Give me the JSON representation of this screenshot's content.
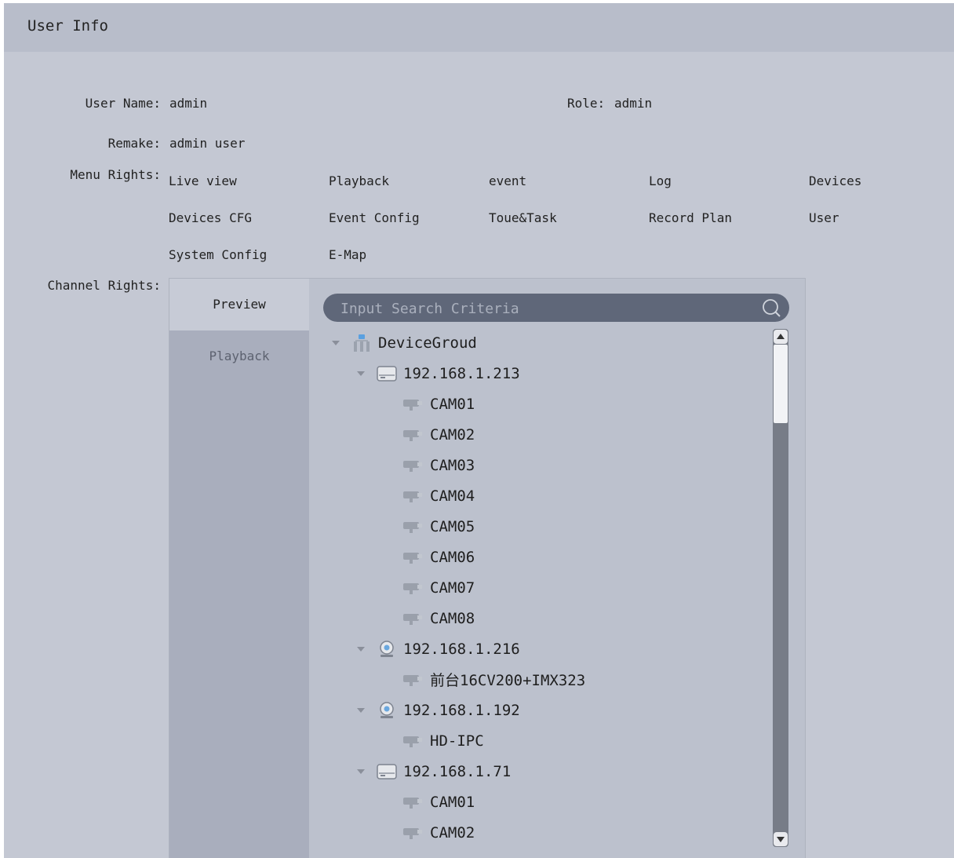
{
  "window": {
    "title": "User Info"
  },
  "user": {
    "name_label": "User Name:",
    "name_value": "admin",
    "role_label": "Role:",
    "role_value": "admin",
    "remark_label": "Remake:",
    "remark_value": "admin user"
  },
  "menu_rights": {
    "label": "Menu Rights:",
    "items": [
      "Live view",
      "Playback",
      "event",
      "Log",
      "Devices",
      "Devices CFG",
      "Event Config",
      "Toue&Task",
      "Record Plan",
      "User",
      "System Config",
      "E-Map"
    ]
  },
  "channel_rights": {
    "label": "Channel Rights:",
    "tabs": [
      "Preview",
      "Playback"
    ],
    "search_placeholder": "Input Search Criteria",
    "tree": [
      {
        "label": "DeviceGroud",
        "icon": "device-group-icon",
        "expanded": true
      },
      {
        "label": "192.168.1.213",
        "icon": "nvr-icon",
        "expanded": true
      },
      {
        "label": "CAM01",
        "icon": "camera-icon"
      },
      {
        "label": "CAM02",
        "icon": "camera-icon"
      },
      {
        "label": "CAM03",
        "icon": "camera-icon"
      },
      {
        "label": "CAM04",
        "icon": "camera-icon"
      },
      {
        "label": "CAM05",
        "icon": "camera-icon"
      },
      {
        "label": "CAM06",
        "icon": "camera-icon"
      },
      {
        "label": "CAM07",
        "icon": "camera-icon"
      },
      {
        "label": "CAM08",
        "icon": "camera-icon"
      },
      {
        "label": "192.168.1.216",
        "icon": "ipc-icon",
        "expanded": true
      },
      {
        "label": "前台16CV200+IMX323",
        "icon": "camera-icon"
      },
      {
        "label": "192.168.1.192",
        "icon": "ipc-icon",
        "expanded": true
      },
      {
        "label": "HD-IPC",
        "icon": "camera-icon"
      },
      {
        "label": "192.168.1.71",
        "icon": "nvr-icon",
        "expanded": true
      },
      {
        "label": "CAM01",
        "icon": "camera-icon"
      },
      {
        "label": "CAM02",
        "icon": "camera-icon"
      }
    ]
  }
}
